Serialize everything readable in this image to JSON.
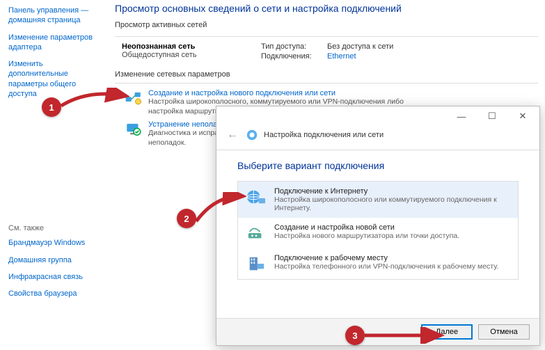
{
  "sidebar": {
    "items": [
      "Панель управления — домашняя страница",
      "Изменение параметров адаптера",
      "Изменить дополнительные параметры общего доступа"
    ],
    "seealso_label": "См. также",
    "seealso": [
      "Брандмауэр Windows",
      "Домашняя группа",
      "Инфракрасная связь",
      "Свойства браузера"
    ]
  },
  "main": {
    "title": "Просмотр основных сведений о сети и настройка подключений",
    "active_header": "Просмотр активных сетей",
    "network": {
      "name": "Неопознанная сеть",
      "type": "Общедоступная сеть",
      "access_label": "Тип доступа:",
      "access_value": "Без доступа к сети",
      "conn_label": "Подключения:",
      "conn_value": "Ethernet"
    },
    "change_header": "Изменение сетевых параметров",
    "tasks": [
      {
        "title": "Создание и настройка нового подключения или сети",
        "desc": "Настройка широкополосного, коммутируемого или VPN-подключения либо настройка маршрутизатора или"
      },
      {
        "title": "Устранение неполад",
        "desc": "Диагностика и испра\nнеполадок."
      }
    ]
  },
  "dialog": {
    "wizard_title": "Настройка подключения или сети",
    "heading": "Выберите вариант подключения",
    "options": [
      {
        "title": "Подключение к Интернету",
        "desc": "Настройка широкополосного или коммутируемого подключения к Интернету."
      },
      {
        "title": "Создание и настройка новой сети",
        "desc": "Настройка нового маршрутизатора или точки доступа."
      },
      {
        "title": "Подключение к рабочему месту",
        "desc": "Настройка телефонного или VPN-подключения к рабочему месту."
      }
    ],
    "buttons": {
      "next": "Далее",
      "cancel": "Отмена"
    }
  },
  "callouts": {
    "b1": "1",
    "b2": "2",
    "b3": "3"
  }
}
